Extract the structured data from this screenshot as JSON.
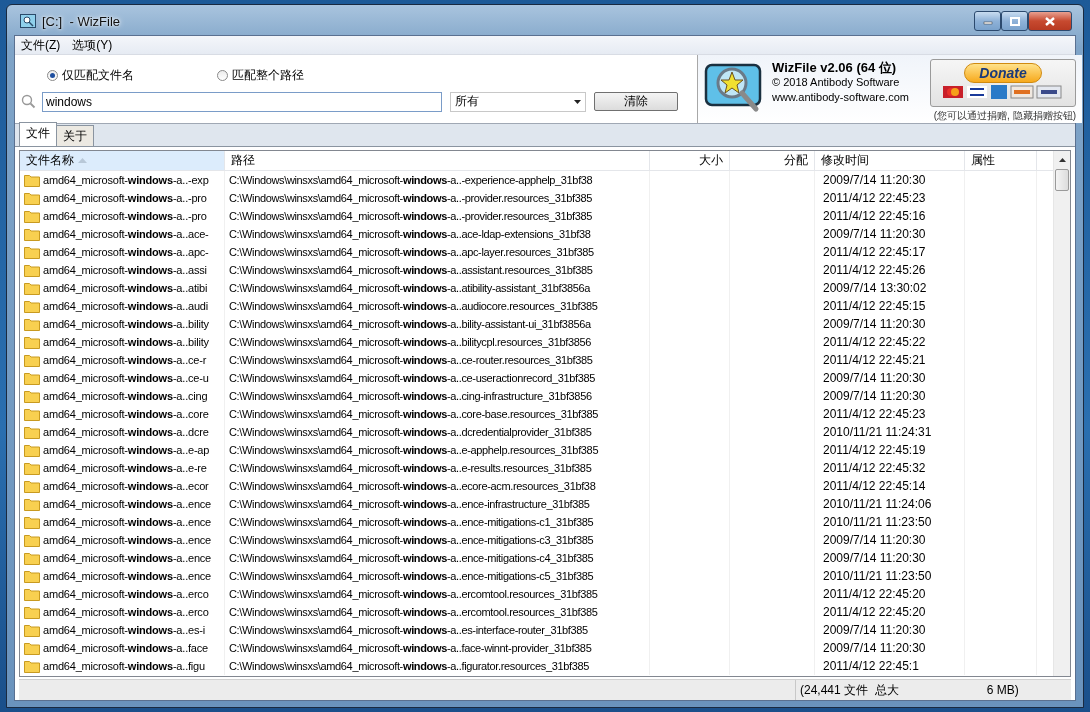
{
  "window": {
    "title": "[C:]  - WizFile"
  },
  "menu": [
    "文件(Z)",
    "选项(Y)"
  ],
  "match_options": [
    {
      "label": "仅匹配文件名",
      "selected": true
    },
    {
      "label": "匹配整个路径",
      "selected": false
    }
  ],
  "search": {
    "value": "windows"
  },
  "filter": {
    "value": "所有"
  },
  "clear_button": "清除",
  "about": {
    "title": "WizFile v2.06 (64 位)",
    "copyright": "© 2018 Antibody Software",
    "website": "www.antibody-software.com"
  },
  "donate": {
    "button": "Donate",
    "note": "(您可以通过捐赠, 隐藏捐赠按钮)"
  },
  "tabs": [
    {
      "label": "文件",
      "selected": true
    },
    {
      "label": "关于",
      "selected": false
    }
  ],
  "table": {
    "columns": [
      {
        "label": "文件名称",
        "sorted": true
      },
      {
        "label": "路径",
        "sorted": false
      },
      {
        "label": "大小",
        "sorted": false
      },
      {
        "label": "分配",
        "sorted": false
      },
      {
        "label": "修改时间",
        "sorted": false
      },
      {
        "label": "属性",
        "sorted": false
      }
    ],
    "rows": [
      {
        "name": "amd64_microsoft-**windows**-a..-exp",
        "path": "C:\\Windows\\winsxs\\amd64_microsoft-**windows**-a..-experience-apphelp_31bf38",
        "modified": "2009/7/14 11:20:30"
      },
      {
        "name": "amd64_microsoft-**windows**-a..-pro",
        "path": "C:\\Windows\\winsxs\\amd64_microsoft-**windows**-a..-provider.resources_31bf385",
        "modified": "2011/4/12 22:45:23"
      },
      {
        "name": "amd64_microsoft-**windows**-a..-pro",
        "path": "C:\\Windows\\winsxs\\amd64_microsoft-**windows**-a..-provider.resources_31bf385",
        "modified": "2011/4/12 22:45:16"
      },
      {
        "name": "amd64_microsoft-**windows**-a..ace-",
        "path": "C:\\Windows\\winsxs\\amd64_microsoft-**windows**-a..ace-ldap-extensions_31bf38",
        "modified": "2009/7/14 11:20:30"
      },
      {
        "name": "amd64_microsoft-**windows**-a..apc-",
        "path": "C:\\Windows\\winsxs\\amd64_microsoft-**windows**-a..apc-layer.resources_31bf385",
        "modified": "2011/4/12 22:45:17"
      },
      {
        "name": "amd64_microsoft-**windows**-a..assi",
        "path": "C:\\Windows\\winsxs\\amd64_microsoft-**windows**-a..assistant.resources_31bf385",
        "modified": "2011/4/12 22:45:26"
      },
      {
        "name": "amd64_microsoft-**windows**-a..atibi",
        "path": "C:\\Windows\\winsxs\\amd64_microsoft-**windows**-a..atibility-assistant_31bf3856a",
        "modified": "2009/7/14 13:30:02"
      },
      {
        "name": "amd64_microsoft-**windows**-a..audi",
        "path": "C:\\Windows\\winsxs\\amd64_microsoft-**windows**-a..audiocore.resources_31bf385",
        "modified": "2011/4/12 22:45:15"
      },
      {
        "name": "amd64_microsoft-**windows**-a..bility",
        "path": "C:\\Windows\\winsxs\\amd64_microsoft-**windows**-a..bility-assistant-ui_31bf3856a",
        "modified": "2009/7/14 11:20:30"
      },
      {
        "name": "amd64_microsoft-**windows**-a..bility",
        "path": "C:\\Windows\\winsxs\\amd64_microsoft-**windows**-a..bilitycpl.resources_31bf3856",
        "modified": "2011/4/12 22:45:22"
      },
      {
        "name": "amd64_microsoft-**windows**-a..ce-r",
        "path": "C:\\Windows\\winsxs\\amd64_microsoft-**windows**-a..ce-router.resources_31bf385",
        "modified": "2011/4/12 22:45:21"
      },
      {
        "name": "amd64_microsoft-**windows**-a..ce-u",
        "path": "C:\\Windows\\winsxs\\amd64_microsoft-**windows**-a..ce-useractionrecord_31bf385",
        "modified": "2009/7/14 11:20:30"
      },
      {
        "name": "amd64_microsoft-**windows**-a..cing",
        "path": "C:\\Windows\\winsxs\\amd64_microsoft-**windows**-a..cing-infrastructure_31bf3856",
        "modified": "2009/7/14 11:20:30"
      },
      {
        "name": "amd64_microsoft-**windows**-a..core",
        "path": "C:\\Windows\\winsxs\\amd64_microsoft-**windows**-a..core-base.resources_31bf385",
        "modified": "2011/4/12 22:45:23"
      },
      {
        "name": "amd64_microsoft-**windows**-a..dcre",
        "path": "C:\\Windows\\winsxs\\amd64_microsoft-**windows**-a..dcredentialprovider_31bf385",
        "modified": "2010/11/21 11:24:31"
      },
      {
        "name": "amd64_microsoft-**windows**-a..e-ap",
        "path": "C:\\Windows\\winsxs\\amd64_microsoft-**windows**-a..e-apphelp.resources_31bf385",
        "modified": "2011/4/12 22:45:19"
      },
      {
        "name": "amd64_microsoft-**windows**-a..e-re",
        "path": "C:\\Windows\\winsxs\\amd64_microsoft-**windows**-a..e-results.resources_31bf385",
        "modified": "2011/4/12 22:45:32"
      },
      {
        "name": "amd64_microsoft-**windows**-a..ecor",
        "path": "C:\\Windows\\winsxs\\amd64_microsoft-**windows**-a..ecore-acm.resources_31bf38",
        "modified": "2011/4/12 22:45:14"
      },
      {
        "name": "amd64_microsoft-**windows**-a..ence",
        "path": "C:\\Windows\\winsxs\\amd64_microsoft-**windows**-a..ence-infrastructure_31bf385",
        "modified": "2010/11/21 11:24:06"
      },
      {
        "name": "amd64_microsoft-**windows**-a..ence",
        "path": "C:\\Windows\\winsxs\\amd64_microsoft-**windows**-a..ence-mitigations-c1_31bf385",
        "modified": "2010/11/21 11:23:50"
      },
      {
        "name": "amd64_microsoft-**windows**-a..ence",
        "path": "C:\\Windows\\winsxs\\amd64_microsoft-**windows**-a..ence-mitigations-c3_31bf385",
        "modified": "2009/7/14 11:20:30"
      },
      {
        "name": "amd64_microsoft-**windows**-a..ence",
        "path": "C:\\Windows\\winsxs\\amd64_microsoft-**windows**-a..ence-mitigations-c4_31bf385",
        "modified": "2009/7/14 11:20:30"
      },
      {
        "name": "amd64_microsoft-**windows**-a..ence",
        "path": "C:\\Windows\\winsxs\\amd64_microsoft-**windows**-a..ence-mitigations-c5_31bf385",
        "modified": "2010/11/21 11:23:50"
      },
      {
        "name": "amd64_microsoft-**windows**-a..erco",
        "path": "C:\\Windows\\winsxs\\amd64_microsoft-**windows**-a..ercomtool.resources_31bf385",
        "modified": "2011/4/12 22:45:20"
      },
      {
        "name": "amd64_microsoft-**windows**-a..erco",
        "path": "C:\\Windows\\winsxs\\amd64_microsoft-**windows**-a..ercomtool.resources_31bf385",
        "modified": "2011/4/12 22:45:20"
      },
      {
        "name": "amd64_microsoft-**windows**-a..es-i",
        "path": "C:\\Windows\\winsxs\\amd64_microsoft-**windows**-a..es-interface-router_31bf385",
        "modified": "2009/7/14 11:20:30"
      },
      {
        "name": "amd64_microsoft-**windows**-a..face",
        "path": "C:\\Windows\\winsxs\\amd64_microsoft-**windows**-a..face-winnt-provider_31bf385",
        "modified": "2009/7/14 11:20:30"
      },
      {
        "name": "amd64_microsoft-**windows**-a..figu",
        "path": "C:\\Windows\\winsxs\\amd64_microsoft-**windows**-a..figurator.resources_31bf385",
        "modified": "2011/4/12 22:45:1"
      }
    ]
  },
  "status_bar": {
    "text": "(24,441 文件  总大",
    "text_end": "6 MB)"
  }
}
